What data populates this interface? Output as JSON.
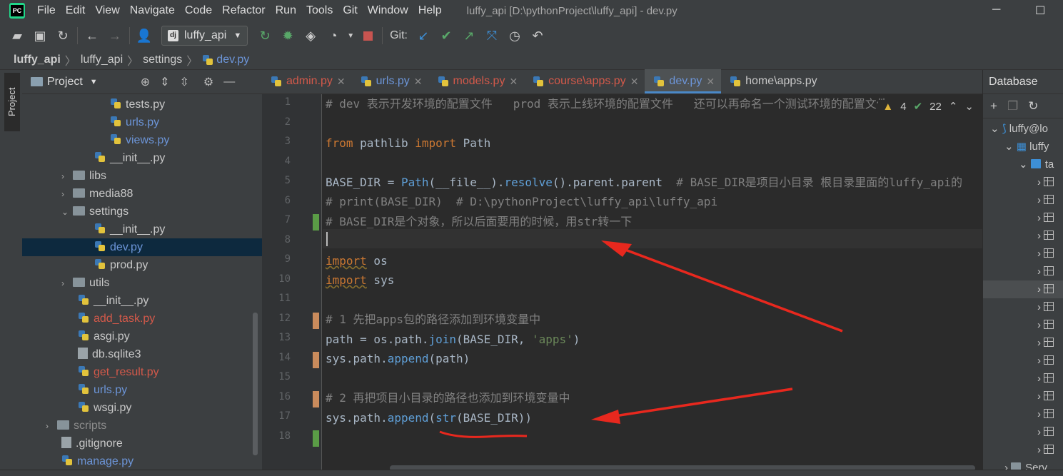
{
  "menubar": {
    "items": [
      "File",
      "Edit",
      "View",
      "Navigate",
      "Code",
      "Refactor",
      "Run",
      "Tools",
      "Git",
      "Window",
      "Help"
    ],
    "window_title": "luffy_api [D:\\pythonProject\\luffy_api] - dev.py",
    "minimize": "─",
    "maximize": "☐"
  },
  "toolbar": {
    "run_config": "luffy_api",
    "git_label": "Git:"
  },
  "breadcrumb": [
    "luffy_api",
    "luffy_api",
    "settings",
    "dev.py"
  ],
  "left_stripe": {
    "project_tab": "Project"
  },
  "project": {
    "title": "Project",
    "rows": [
      {
        "label": "tests.py",
        "kind": "py"
      },
      {
        "label": "urls.py",
        "kind": "py",
        "color": "blue"
      },
      {
        "label": "views.py",
        "kind": "py",
        "color": "blue"
      },
      {
        "label": "__init__.py",
        "kind": "py"
      },
      {
        "label": "libs",
        "kind": "folder",
        "arrow": "›"
      },
      {
        "label": "media88",
        "kind": "folder",
        "arrow": "›"
      },
      {
        "label": "settings",
        "kind": "folder",
        "arrow": "⌄"
      },
      {
        "label": "__init__.py",
        "kind": "py"
      },
      {
        "label": "dev.py",
        "kind": "py",
        "color": "blue",
        "selected": true
      },
      {
        "label": "prod.py",
        "kind": "py"
      },
      {
        "label": "utils",
        "kind": "folder",
        "arrow": "›"
      },
      {
        "label": "__init__.py",
        "kind": "py"
      },
      {
        "label": "add_task.py",
        "kind": "py",
        "color": "red"
      },
      {
        "label": "asgi.py",
        "kind": "py"
      },
      {
        "label": "db.sqlite3",
        "kind": "file"
      },
      {
        "label": "get_result.py",
        "kind": "py",
        "color": "red"
      },
      {
        "label": "urls.py",
        "kind": "py",
        "color": "blue"
      },
      {
        "label": "wsgi.py",
        "kind": "py"
      },
      {
        "label": "scripts",
        "kind": "folder",
        "arrow": "›",
        "color": "grey"
      },
      {
        "label": ".gitignore",
        "kind": "file"
      },
      {
        "label": "manage.py",
        "kind": "py",
        "color": "blue"
      }
    ]
  },
  "tabs": [
    {
      "label": "admin.py",
      "color": "red"
    },
    {
      "label": "urls.py",
      "color": "blue"
    },
    {
      "label": "models.py",
      "color": "red"
    },
    {
      "label": "course\\apps.py",
      "color": "red"
    },
    {
      "label": "dev.py",
      "color": "blue",
      "active": true
    },
    {
      "label": "home\\apps.py"
    }
  ],
  "inspection": {
    "warnings": "4",
    "checks": "22"
  },
  "line_numbers": [
    "1",
    "2",
    "3",
    "4",
    "5",
    "6",
    "7",
    "8",
    "9",
    "10",
    "11",
    "12",
    "13",
    "14",
    "15",
    "16",
    "17",
    "18"
  ],
  "code": {
    "l1": "# dev 表示开发环境的配置文件   prod 表示上线环境的配置文件   还可以再命名一个测试环境的配置文件",
    "l3_kw1": "from",
    "l3_mod": " pathlib ",
    "l3_kw2": "import",
    "l3_name": " Path",
    "l5_a": "BASE_DIR = ",
    "l5_b": "Path",
    "l5_c": "(__file__).",
    "l5_d": "resolve",
    "l5_e": "().parent.parent  ",
    "l5_f": "# BASE_DIR是项目小目录 根目录里面的luffy_api的",
    "l6": "# print(BASE_DIR)  # D:\\pythonProject\\luffy_api\\luffy_api",
    "l7": "# BASE_DIR是个对象，所以后面要用的时候，用str转一下",
    "l9_kw": "import",
    "l9_mod": " os",
    "l10_kw": "import",
    "l10_mod": " sys",
    "l12": "# 1 先把apps包的路径添加到环境变量中",
    "l13_a": "path = os.path.",
    "l13_b": "join",
    "l13_c": "(BASE_DIR, ",
    "l13_d": "'apps'",
    "l13_e": ")",
    "l14_a": "sys.path.",
    "l14_b": "append",
    "l14_c": "(path)",
    "l16": "# 2 再把项目小目录的路径也添加到环境变量中",
    "l17_a": "sys.path.",
    "l17_b": "append",
    "l17_c": "(",
    "l17_d": "str",
    "l17_e": "(BASE_DIR))"
  },
  "database": {
    "title": "Database",
    "conn": "luffy@lo",
    "schema": "luffy",
    "tables_folder": "ta",
    "server": "Serv"
  },
  "colors": {
    "accent": "#4a88c7",
    "annotation": "#e8281e",
    "vcs_modified": "#c98b5c",
    "vcs_added": "#5a9c46"
  }
}
